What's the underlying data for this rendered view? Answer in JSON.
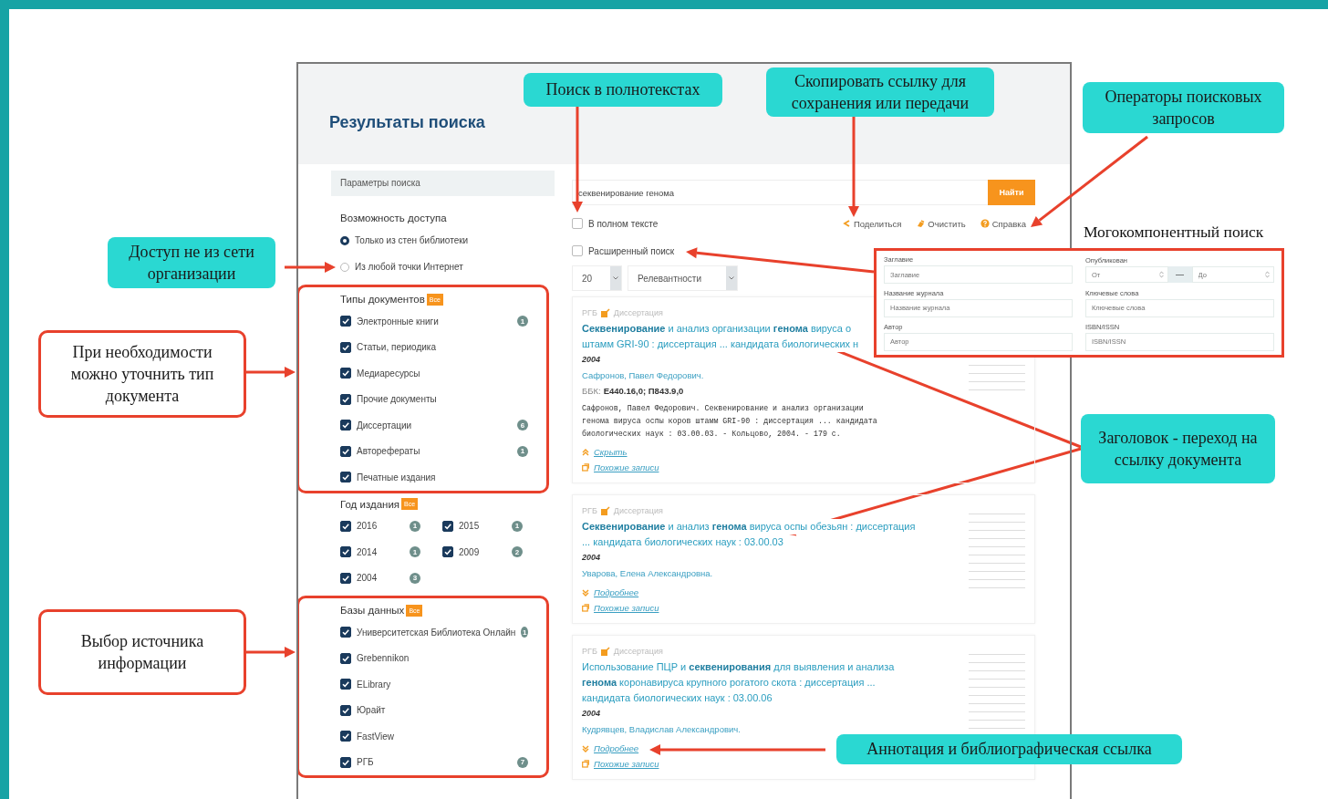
{
  "screen": {
    "title": "Результаты поиска",
    "sidebar": {
      "header": "Параметры поиска",
      "access": {
        "title": "Возможность доступа",
        "options": [
          {
            "label": "Только из стен библиотеки",
            "selected": true
          },
          {
            "label": "Из любой точки Интернет",
            "selected": false
          }
        ]
      },
      "filters": [
        {
          "title": "Типы документов",
          "badge": "Все",
          "highlighted": true,
          "kind": "list",
          "items": [
            {
              "label": "Электронные книги",
              "checked": true,
              "count": "1"
            },
            {
              "label": "Статьи, периодика",
              "checked": true
            },
            {
              "label": "Медиаресурсы",
              "checked": true
            },
            {
              "label": "Прочие документы",
              "checked": true
            },
            {
              "label": "Диссертации",
              "checked": true,
              "count": "6"
            },
            {
              "label": "Авторефераты",
              "checked": true,
              "count": "1"
            },
            {
              "label": "Печатные издания",
              "checked": true
            }
          ]
        },
        {
          "title": "Год издания",
          "badge": "Все",
          "highlighted": false,
          "kind": "grid",
          "items": [
            {
              "label": "2016",
              "checked": true,
              "count": "1"
            },
            {
              "label": "2015",
              "checked": true,
              "count": "1"
            },
            {
              "label": "2014",
              "checked": true,
              "count": "1"
            },
            {
              "label": "2009",
              "checked": true,
              "count": "2"
            },
            {
              "label": "2004",
              "checked": true,
              "count": "3"
            }
          ]
        },
        {
          "title": "Базы данных",
          "badge": "Все",
          "highlighted": true,
          "kind": "list",
          "items": [
            {
              "label": "Университетская Библиотека Онлайн",
              "checked": true,
              "count": "1"
            },
            {
              "label": "Grebennikon",
              "checked": true
            },
            {
              "label": "ELibrary",
              "checked": true
            },
            {
              "label": "Юрайт",
              "checked": true
            },
            {
              "label": "FastView",
              "checked": true
            },
            {
              "label": "РГБ",
              "checked": true,
              "count": "7"
            }
          ]
        }
      ]
    },
    "search": {
      "query": "секвенирование генома",
      "button": "Найти",
      "options": [
        {
          "label": "В полном тексте",
          "checked": false
        },
        {
          "label": "Расширенный поиск",
          "checked": false
        }
      ],
      "actions": [
        {
          "label": "Поделиться",
          "kind": "share"
        },
        {
          "label": "Очистить",
          "kind": "clear"
        },
        {
          "label": "Справка",
          "kind": "help"
        }
      ],
      "page_size": "20",
      "sort": "Релевантности"
    },
    "results": [
      {
        "source": "РГБ",
        "type": "Диссертация",
        "title_lines": [
          "**Секвенирование** и анализ организации **генома** вируса о",
          "штамм GRI-90 : диссертация ... кандидата биологических н"
        ],
        "year": "2004",
        "author": "Сафронов, Павел Федорович.",
        "bbk_label": "ББК:",
        "bbk": "Е440.16,0; П843.9,0",
        "citation": [
          "Сафронов, Павел Федорович. Секвенирование и анализ организации",
          "генома вируса оспы коров штамм GRI-90 : диссертация ... кандидата",
          "биологических наук : 03.00.03. - Кольцово, 2004. - 179 с."
        ],
        "links": [
          {
            "label": "Скрыть",
            "kind": "collapse"
          },
          {
            "label": "Похожие записи",
            "kind": "similar"
          }
        ]
      },
      {
        "source": "РГБ",
        "type": "Диссертация",
        "title_lines": [
          "**Секвенирование** и анализ **генома** вируса оспы обезьян : диссертация",
          "... кандидата биологических наук : 03.00.03"
        ],
        "year": "2004",
        "author": "Уварова, Елена Александровна.",
        "links": [
          {
            "label": "Подробнее",
            "kind": "expand"
          },
          {
            "label": "Похожие записи",
            "kind": "similar"
          }
        ]
      },
      {
        "source": "РГБ",
        "type": "Диссертация",
        "title_lines": [
          "Использование ПЦР и **секвенирования** для выявления и анализа",
          "**генома** коронавируса крупного рогатого скота : диссертация ...",
          "кандидата биологических наук : 03.00.06"
        ],
        "year": "2004",
        "author": "Кудрявцев, Владислав Александрович.",
        "links": [
          {
            "label": "Подробнее",
            "kind": "expand"
          },
          {
            "label": "Похожие записи",
            "kind": "similar"
          }
        ]
      }
    ],
    "advanced_form": {
      "fields": [
        {
          "kind": "text",
          "label": "Заглавие",
          "placeholder": "Заглавие"
        },
        {
          "kind": "range",
          "label": "Опубликован",
          "placeholder_from": "От",
          "separator": "—",
          "placeholder_to": "До"
        },
        {
          "kind": "text",
          "label": "Название журнала",
          "placeholder": "Название журнала"
        },
        {
          "kind": "text",
          "label": "Ключевые слова",
          "placeholder": "Ключевые слова"
        },
        {
          "kind": "text",
          "label": "Автор",
          "placeholder": "Автор"
        },
        {
          "kind": "text",
          "label": "ISBN/ISSN",
          "placeholder": "ISBN/ISSN"
        }
      ]
    }
  },
  "annotations": {
    "caption": "Могокомпонентный поиск",
    "callouts": [
      {
        "text": "Поиск в полнотекстах",
        "kind": "teal"
      },
      {
        "text": "Скопировать ссылку для сохранения или передачи",
        "kind": "teal"
      },
      {
        "text": "Операторы поисковых запросов",
        "kind": "teal"
      },
      {
        "text": "Доступ не из сети организации",
        "kind": "teal"
      },
      {
        "text": "При необходимости можно уточнить тип документа",
        "kind": "boxed"
      },
      {
        "text": "Выбор источника информации",
        "kind": "boxed"
      },
      {
        "text": "Заголовок - переход на ссылку документа",
        "kind": "teal"
      },
      {
        "text": "Аннотация и библиографическая ссылка",
        "kind": "teal"
      }
    ]
  }
}
